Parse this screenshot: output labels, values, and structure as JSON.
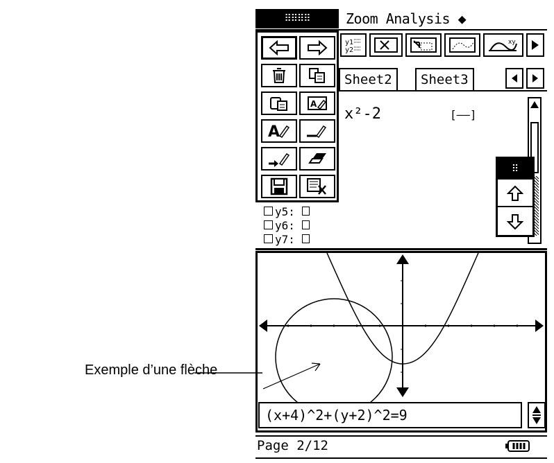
{
  "menubar": {
    "menu_icon": "menu-dots-icon",
    "menu_dots": "⠿⠿⠿⠿",
    "zoom_label": "Zoom",
    "analysis_label": "Analysis",
    "diamond": "◆"
  },
  "toolbar": {
    "icons": [
      "table-icon",
      "zoom-box-icon",
      "zoom-in-icon",
      "trace-icon",
      "sketch-icon"
    ],
    "more_icon": "play-right-icon"
  },
  "tabs": [
    {
      "label": "Sheet2"
    },
    {
      "label": "Sheet3"
    }
  ],
  "editor": {
    "formula": "x²-2",
    "line_style": "[——]",
    "rows": [
      {
        "label": "y5: "
      },
      {
        "label": "y6: "
      },
      {
        "label": "y7: "
      }
    ]
  },
  "popup_menu": {
    "items": [
      {
        "icon": "undo-arrow-icon",
        "glyph": "⇦"
      },
      {
        "icon": "redo-arrow-icon",
        "glyph": "⇨"
      },
      {
        "icon": "trash-icon",
        "glyph": "🗑"
      },
      {
        "icon": "copy-icon",
        "glyph": "⧉"
      },
      {
        "icon": "paste-icon",
        "glyph": "📋"
      },
      {
        "icon": "rename-icon",
        "glyph": "A✎"
      },
      {
        "icon": "text-pen-icon",
        "glyph": "A✎"
      },
      {
        "icon": "line-pen-icon",
        "glyph": "—✎"
      },
      {
        "icon": "arrow-pen-icon",
        "glyph": "→✎"
      },
      {
        "icon": "eraser-icon",
        "glyph": "⌫"
      },
      {
        "icon": "save-icon",
        "glyph": "💾"
      },
      {
        "icon": "clear-sheet-icon",
        "glyph": "⊠"
      }
    ]
  },
  "small_popup": {
    "dots": "⠿",
    "up_icon": "up-arrow-icon",
    "down_icon": "down-arrow-icon"
  },
  "graph": {
    "input_expression": "(x+4)^2+(y+2)^2=9"
  },
  "status": {
    "page_text": "Page 2/12",
    "battery_icon": "battery-icon"
  },
  "caption": "Exemple d’une flèche"
}
